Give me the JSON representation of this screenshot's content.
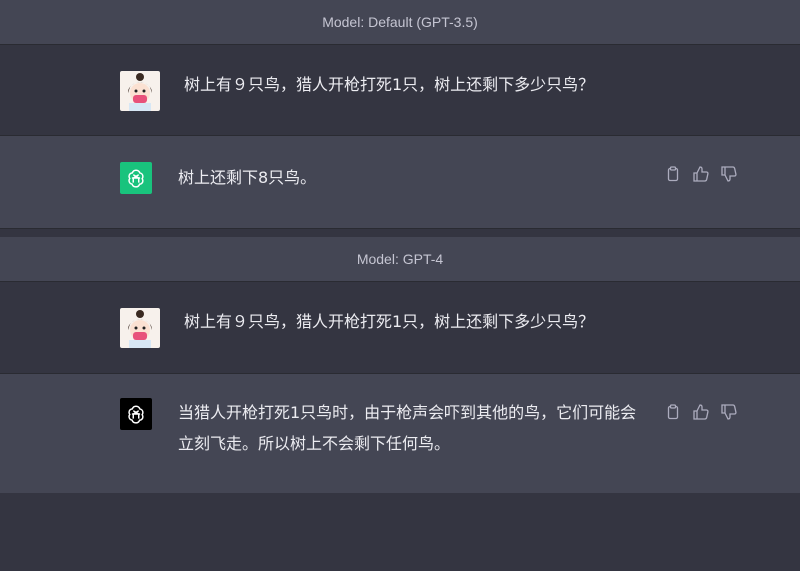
{
  "sections": [
    {
      "model_label": "Model: Default (GPT-3.5)",
      "user_message": "树上有９只鸟，猎人开枪打死1只，树上还剩下多少只鸟？",
      "assistant_message": "树上还剩下8只鸟。",
      "bot_color": "#19c37d"
    },
    {
      "model_label": "Model: GPT-4",
      "user_message": "树上有９只鸟，猎人开枪打死1只，树上还剩下多少只鸟？",
      "assistant_message_line1": "当猎人开枪打死1只鸟时，由于枪声会吓到其他的鸟，它们可能会",
      "assistant_message_line2": "立刻飞走。所以树上不会剩下任何鸟。",
      "bot_color": "#000000"
    }
  ],
  "icons": [
    "copy-icon",
    "thumbs-up-icon",
    "thumbs-down-icon"
  ],
  "colors": {
    "background": "#343541",
    "assistant_row": "#444654",
    "text": "#ececf1"
  }
}
